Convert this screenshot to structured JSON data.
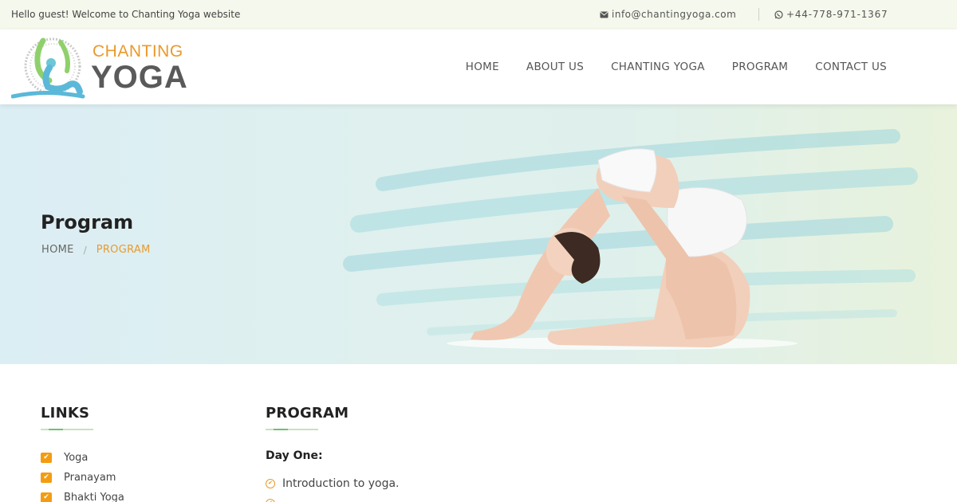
{
  "topbar": {
    "welcome": "Hello guest! Welcome to Chanting Yoga website",
    "email": "info@chantingyoga.com",
    "phone": "+44-778-971-1367",
    "email_icon": "envelope-icon",
    "phone_icon": "whatsapp-icon"
  },
  "logo": {
    "line1": "CHANTING",
    "line2": "YOGA"
  },
  "nav": {
    "items": [
      {
        "label": "HOME"
      },
      {
        "label": "ABOUT US"
      },
      {
        "label": "CHANTING YOGA"
      },
      {
        "label": "PROGRAM"
      },
      {
        "label": "CONTACT US"
      }
    ]
  },
  "banner": {
    "title": "Program",
    "breadcrumb": {
      "home": "HOME",
      "separator": "/",
      "current": "PROGRAM"
    }
  },
  "links": {
    "heading": "LINKS",
    "items": [
      {
        "label": "Yoga"
      },
      {
        "label": "Pranayam"
      },
      {
        "label": "Bhakti Yoga"
      }
    ]
  },
  "program": {
    "heading": "PROGRAM",
    "day": "Day One:",
    "items": [
      {
        "label": "Introduction to yoga."
      }
    ]
  },
  "colors": {
    "accent": "#e99a2c",
    "checkbox": "#f39c12",
    "underline": "#6fbf73",
    "topbar_bg": "#f5f8ec"
  }
}
